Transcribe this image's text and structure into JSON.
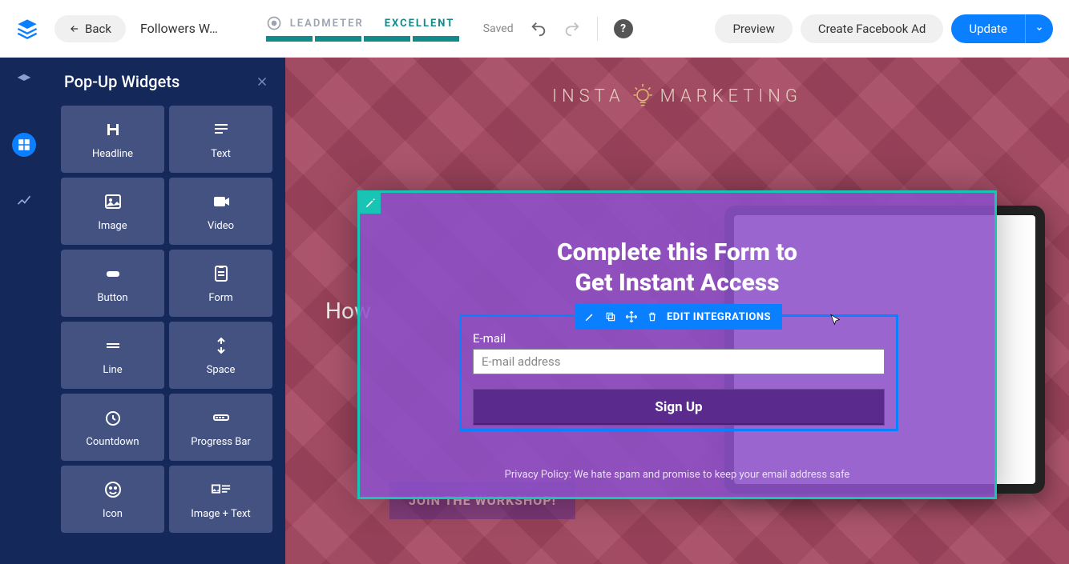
{
  "topbar": {
    "back_label": "Back",
    "page_name": "Followers W…",
    "leadmeter_label": "LEADMETER",
    "leadmeter_status": "EXCELLENT",
    "leadmeter_segments": 4,
    "saved_label": "Saved",
    "preview_label": "Preview",
    "facebook_ad_label": "Create Facebook Ad",
    "update_label": "Update"
  },
  "sidebar": {
    "title": "Pop-Up Widgets",
    "widgets": [
      {
        "label": "Headline",
        "icon": "headline-icon"
      },
      {
        "label": "Text",
        "icon": "text-icon"
      },
      {
        "label": "Image",
        "icon": "image-icon"
      },
      {
        "label": "Video",
        "icon": "video-icon"
      },
      {
        "label": "Button",
        "icon": "button-icon"
      },
      {
        "label": "Form",
        "icon": "form-icon"
      },
      {
        "label": "Line",
        "icon": "line-icon"
      },
      {
        "label": "Space",
        "icon": "space-icon"
      },
      {
        "label": "Countdown",
        "icon": "countdown-icon"
      },
      {
        "label": "Progress Bar",
        "icon": "progressbar-icon"
      },
      {
        "label": "Icon",
        "icon": "icon-icon"
      },
      {
        "label": "Image + Text",
        "icon": "imagetext-icon"
      }
    ]
  },
  "canvas": {
    "brand_left": "INSTA",
    "brand_right": "MARKETING",
    "bg_heading_prefix": "How",
    "bg_cta": "JOIN THE WORKSHOP!"
  },
  "popup": {
    "title_line1": "Complete this Form to",
    "title_line2": "Get Instant Access",
    "privacy": "Privacy Policy: We hate spam and promise to keep your email address safe"
  },
  "form": {
    "toolbar_action": "EDIT INTEGRATIONS",
    "field_label": "E-mail",
    "field_placeholder": "E-mail address",
    "submit_label": "Sign Up"
  },
  "colors": {
    "primary_blue": "#0a7fff",
    "teal": "#138a8a",
    "sidebar_bg": "#15285a",
    "popup_purple": "#8c50c8",
    "cta_purple": "#5a2b8c",
    "page_tint": "#962846"
  }
}
